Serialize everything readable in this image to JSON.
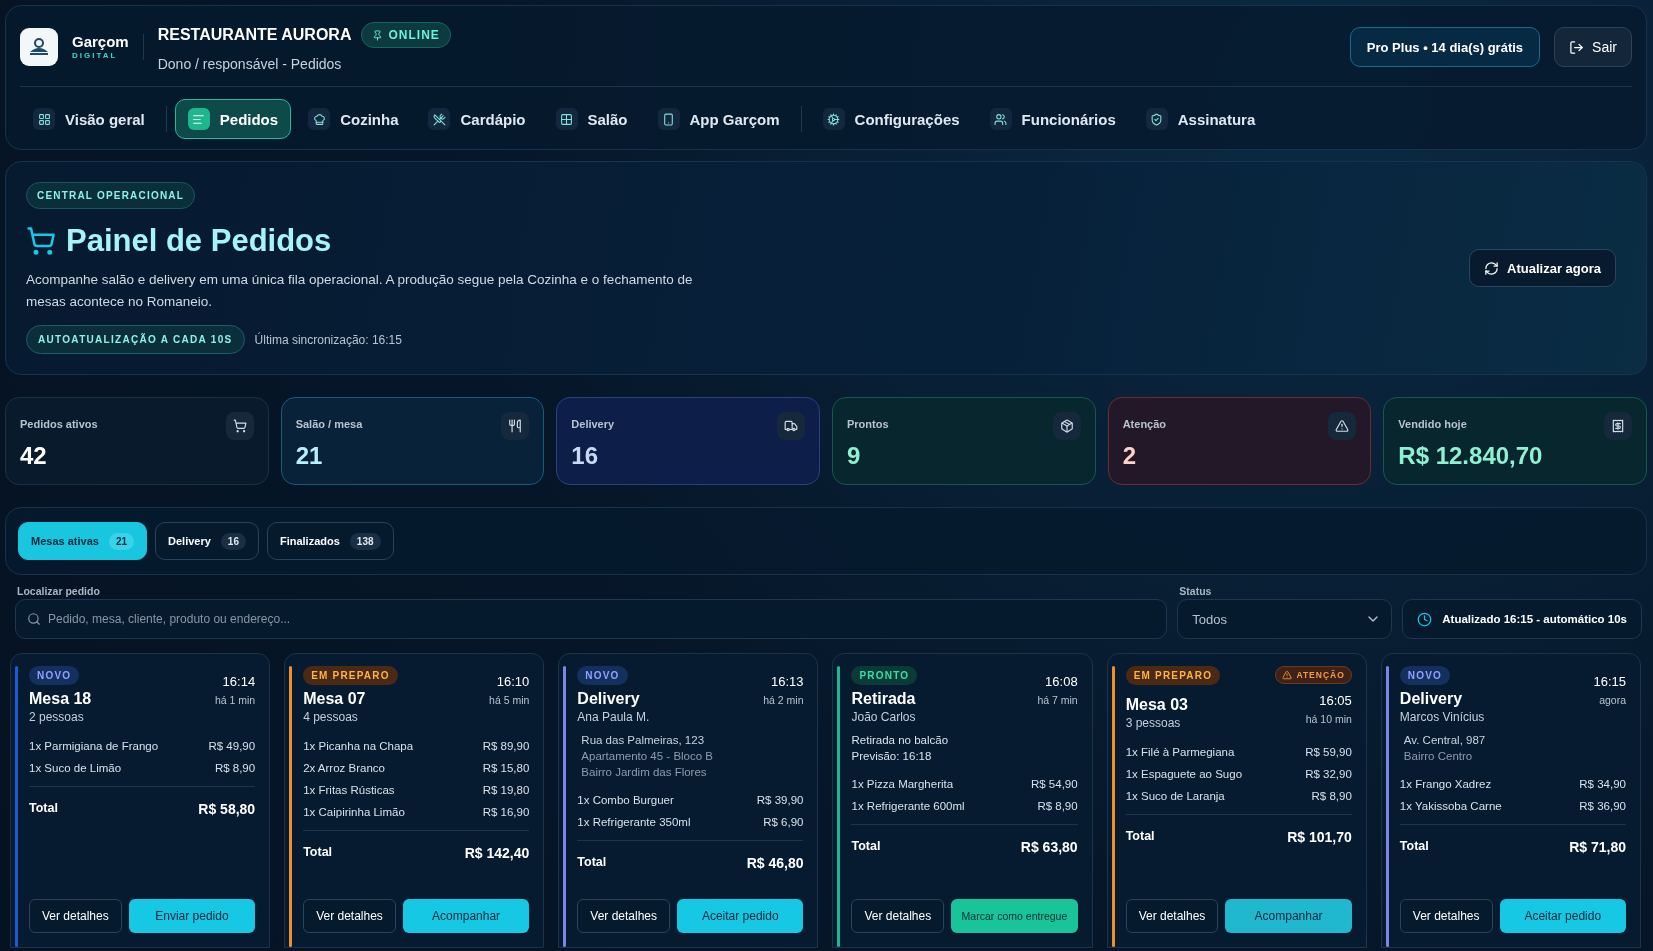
{
  "brand": {
    "name": "Garçom",
    "tagline": "DIGITAL"
  },
  "restaurant": {
    "name": "RESTAURANTE AURORA",
    "status": "ONLINE",
    "online": true,
    "breadcrumb": "Dono / responsável - Pedidos"
  },
  "plan_button": "Pro Plus • 14 dia(s) grátis",
  "logout_button": "Sair",
  "nav": [
    {
      "label": "Visão geral",
      "selected": false
    },
    {
      "label": "Pedidos",
      "selected": true
    },
    {
      "label": "Cozinha",
      "selected": false
    },
    {
      "label": "Cardápio",
      "selected": false
    },
    {
      "label": "Salão",
      "selected": false
    },
    {
      "label": "App Garçom",
      "selected": false
    },
    {
      "label": "Configurações",
      "selected": false
    },
    {
      "label": "Funcionários",
      "selected": false
    },
    {
      "label": "Assinatura",
      "selected": false
    }
  ],
  "hero": {
    "eyebrow": "CENTRAL OPERACIONAL",
    "title": "Painel de Pedidos",
    "description": "Acompanhe salão e delivery em uma única fila operacional. A produção segue pela Cozinha e o fechamento de mesas acontece no Romaneio.",
    "auto_badge": "AUTOATUALIZAÇÃO A CADA 10S",
    "sync": "Última sincronização: 16:15",
    "refresh_button": "Atualizar agora"
  },
  "stats": [
    {
      "label": "Pedidos ativos",
      "value": "42",
      "kind": "neutral"
    },
    {
      "label": "Salão / mesa",
      "value": "21",
      "kind": "cyan"
    },
    {
      "label": "Delivery",
      "value": "16",
      "kind": "indigo"
    },
    {
      "label": "Prontos",
      "value": "9",
      "kind": "green"
    },
    {
      "label": "Atenção",
      "value": "2",
      "kind": "red"
    },
    {
      "label": "Vendido hoje",
      "value": "R$ 12.840,70",
      "kind": "green"
    }
  ],
  "tabs": [
    {
      "label": "Mesas ativas",
      "count": "21",
      "selected": true
    },
    {
      "label": "Delivery",
      "count": "16",
      "selected": false
    },
    {
      "label": "Finalizados",
      "count": "138",
      "selected": false
    }
  ],
  "search": {
    "label": "Localizar pedido",
    "placeholder": "Pedido, mesa, cliente, produto ou endereço..."
  },
  "status_filter": {
    "label": "Status",
    "value": "Todos"
  },
  "updated": "Atualizado 16:15 - automático 10s",
  "orders": [
    {
      "status": "NOVO",
      "kind": "novo",
      "color": "#1d5ad6",
      "title": "Mesa 18",
      "subtitle": "2 pessoas",
      "time": "16:14",
      "ago": "há 1 min",
      "items": [
        {
          "name": "1x Parmigiana de Frango",
          "price": "R$ 49,90"
        },
        {
          "name": "1x Suco de Limão",
          "price": "R$ 8,90"
        }
      ],
      "total_label": "Total",
      "total": "R$ 58,80",
      "secondary": "Ver detalhes",
      "primary": {
        "label": "Enviar pedido",
        "kind": "cyan"
      }
    },
    {
      "status": "EM PREPARO",
      "kind": "preparo",
      "color": "#f0902a",
      "title": "Mesa 07",
      "subtitle": "4 pessoas",
      "time": "16:10",
      "ago": "há 5 min",
      "items": [
        {
          "name": "1x Picanha na Chapa",
          "price": "R$ 89,90"
        },
        {
          "name": "2x Arroz Branco",
          "price": "R$ 15,80"
        },
        {
          "name": "1x Fritas Rústicas",
          "price": "R$ 19,80"
        },
        {
          "name": "1x Caipirinha Limão",
          "price": "R$ 16,90"
        }
      ],
      "total_label": "Total",
      "total": "R$ 142,40",
      "secondary": "Ver detalhes",
      "primary": {
        "label": "Acompanhar",
        "kind": "cyan"
      }
    },
    {
      "status": "NOVO",
      "kind": "novo",
      "color": "#7d86e6",
      "title": "Delivery",
      "subtitle": "Ana Paula M.",
      "time": "16:13",
      "ago": "há 2 min",
      "details": {
        "kind": "address",
        "lines": [
          "Rua das Palmeiras, 123",
          "Apartamento 45 - Bloco B",
          "Bairro Jardim das Flores"
        ]
      },
      "items": [
        {
          "name": "1x Combo Burguer",
          "price": "R$ 39,90"
        },
        {
          "name": "1x Refrigerante 350ml",
          "price": "R$ 6,90"
        }
      ],
      "total_label": "Total",
      "total": "R$ 46,80",
      "secondary": "Ver detalhes",
      "primary": {
        "label": "Aceitar pedido",
        "kind": "cyan"
      }
    },
    {
      "status": "PRONTO",
      "kind": "pronto",
      "color": "#1fb58f",
      "title": "Retirada",
      "subtitle": "João Carlos",
      "time": "16:08",
      "ago": "há 7 min",
      "details": {
        "kind": "note",
        "lines": [
          "Retirada no balcão",
          "Previsão: 16:18"
        ]
      },
      "items": [
        {
          "name": "1x Pizza Margherita",
          "price": "R$ 54,90"
        },
        {
          "name": "1x Refrigerante 600ml",
          "price": "R$ 8,90"
        }
      ],
      "total_label": "Total",
      "total": "R$ 63,80",
      "secondary": "Ver detalhes",
      "primary": {
        "label": "Marcar como entregue",
        "kind": "green"
      }
    },
    {
      "status": "EM PREPARO",
      "kind": "preparo",
      "color": "#f0902a",
      "alert": "ATENÇÃO",
      "title": "Mesa 03",
      "subtitle": "3 pessoas",
      "time": "16:05",
      "ago": "há 10 min",
      "items": [
        {
          "name": "1x Filé à Parmegiana",
          "price": "R$ 59,90"
        },
        {
          "name": "1x Espaguete ao Sugo",
          "price": "R$ 32,90"
        },
        {
          "name": "1x Suco de Laranja",
          "price": "R$ 8,90"
        }
      ],
      "total_label": "Total",
      "total": "R$ 101,70",
      "secondary": "Ver detalhes",
      "primary": {
        "label": "Acompanhar",
        "kind": "teal"
      }
    },
    {
      "status": "NOVO",
      "kind": "novo",
      "color": "#7d86e6",
      "title": "Delivery",
      "subtitle": "Marcos Vinícius",
      "time": "16:15",
      "ago": "agora",
      "details": {
        "kind": "address",
        "lines": [
          "Av. Central, 987",
          "Bairro Centro"
        ]
      },
      "items": [
        {
          "name": "1x Frango Xadrez",
          "price": "R$ 34,90"
        },
        {
          "name": "1x Yakissoba Carne",
          "price": "R$ 36,90"
        }
      ],
      "total_label": "Total",
      "total": "R$ 71,80",
      "secondary": "Ver detalhes",
      "primary": {
        "label": "Aceitar pedido",
        "kind": "cyan"
      }
    }
  ]
}
